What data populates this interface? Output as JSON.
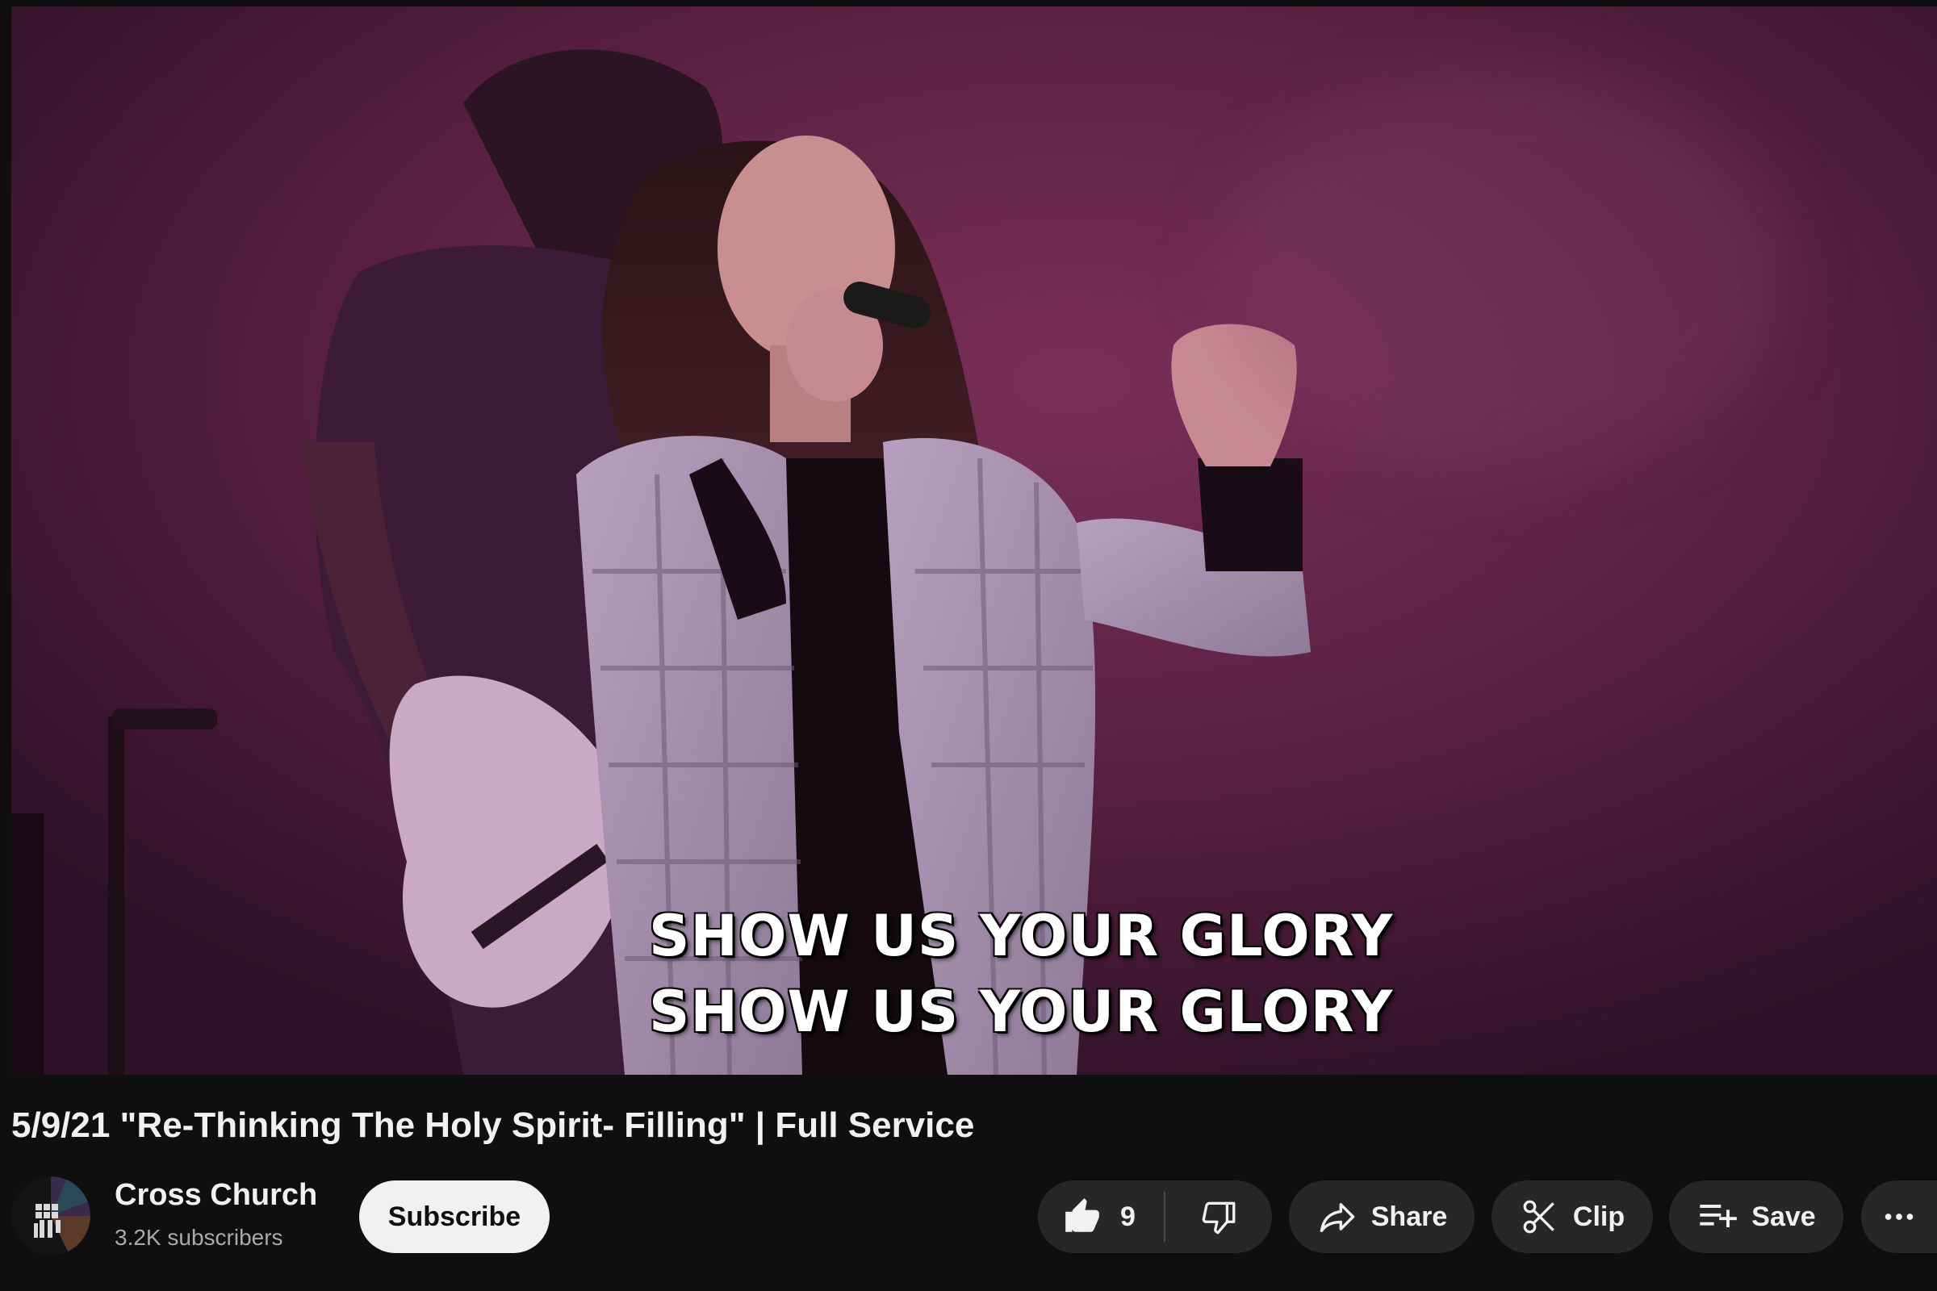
{
  "video": {
    "captions": [
      "SHOW US YOUR GLORY",
      "SHOW US YOUR GLORY"
    ]
  },
  "title": "5/9/21 \"Re-Thinking The Holy Spirit- Filling\" | Full Service",
  "channel": {
    "name": "Cross Church",
    "subscribers": "3.2K subscribers",
    "subscribe_label": "Subscribe"
  },
  "actions": {
    "like_count": "9",
    "share_label": "Share",
    "clip_label": "Clip",
    "save_label": "Save"
  },
  "icons": {
    "like": "thumbs-up-icon",
    "dislike": "thumbs-down-icon",
    "share": "share-arrow-icon",
    "clip": "scissors-icon",
    "save": "playlist-add-icon",
    "more": "more-horizontal-icon"
  },
  "colors": {
    "background": "#0f0f0f",
    "button_bg": "#272727",
    "subscribe_bg": "#f1f1f1",
    "video_tint": "#561f40"
  }
}
